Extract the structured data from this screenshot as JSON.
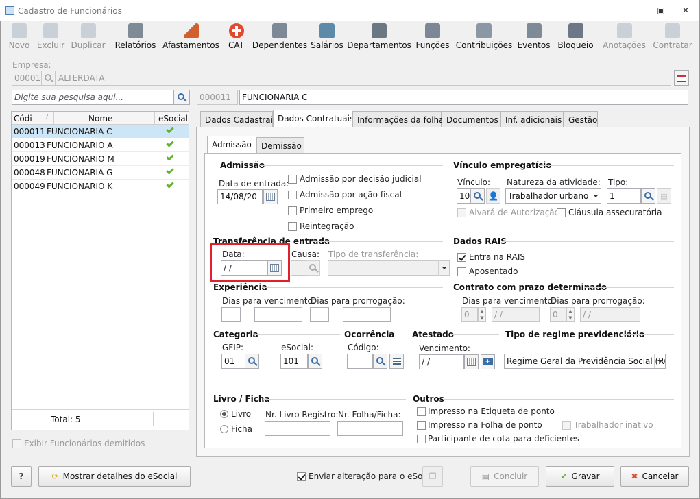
{
  "window": {
    "title": "Cadastro de Funcionários"
  },
  "toolbar": [
    {
      "label": "Novo",
      "icon": "new-icon",
      "disabled": true,
      "color": "#9aa9b8"
    },
    {
      "label": "Excluir",
      "icon": "trash-icon",
      "disabled": true,
      "color": "#9aa9b8"
    },
    {
      "label": "Duplicar",
      "icon": "duplicate-icon",
      "disabled": true,
      "color": "#9aa9b8"
    },
    {
      "label": "Relatórios",
      "icon": "report-icon",
      "disabled": false,
      "color": "#7e8a96"
    },
    {
      "label": "Afastamentos",
      "icon": "house-icon",
      "disabled": false,
      "color": "#d2602f"
    },
    {
      "label": "CAT",
      "icon": "medical-cross-icon",
      "disabled": false,
      "color": "#e2492f"
    },
    {
      "label": "Dependentes",
      "icon": "people-icon",
      "disabled": false,
      "color": "#7d8996"
    },
    {
      "label": "Salários",
      "icon": "money-icon",
      "disabled": false,
      "color": "#5d8aa8"
    },
    {
      "label": "Departamentos",
      "icon": "desk-icon",
      "disabled": false,
      "color": "#6b7884"
    },
    {
      "label": "Funções",
      "icon": "badge-icon",
      "disabled": false,
      "color": "#7b8794"
    },
    {
      "label": "Contribuições",
      "icon": "contribution-icon",
      "disabled": false,
      "color": "#8b97a4"
    },
    {
      "label": "Eventos",
      "icon": "list-icon",
      "disabled": false,
      "color": "#7e8a96"
    },
    {
      "label": "Bloqueio",
      "icon": "lock-icon",
      "disabled": false,
      "color": "#6c7885"
    },
    {
      "label": "Anotações",
      "icon": "notes-icon",
      "disabled": true,
      "color": "#9aa9b8"
    },
    {
      "label": "Contratar",
      "icon": "hire-icon",
      "disabled": true,
      "color": "#9aa9b8"
    }
  ],
  "empresa": {
    "label": "Empresa:",
    "code": "00001",
    "name": "ALTERDATA"
  },
  "search": {
    "placeholder": "Digite sua pesquisa aqui..."
  },
  "selected": {
    "code": "000011",
    "name": "FUNCIONARIA C"
  },
  "grid": {
    "headers": [
      "Códi",
      "Nome",
      "eSocial"
    ],
    "rows": [
      {
        "code": "000011",
        "name": "FUNCIONARIA C"
      },
      {
        "code": "000013",
        "name": "FUNCIONARIO A"
      },
      {
        "code": "000019",
        "name": "FUNCIONARIO M"
      },
      {
        "code": "000048",
        "name": "FUNCIONARIA G"
      },
      {
        "code": "000049",
        "name": "FUNCIONARIO K"
      }
    ],
    "total": "Total: 5"
  },
  "show_dismissed": "Exibir Funcionários demitidos",
  "tabs": [
    "Dados Cadastrais",
    "Dados Contratuais",
    "Informações da folha",
    "Documentos",
    "Inf. adicionais",
    "Gestão"
  ],
  "subtabs": [
    "Admissão",
    "Demissão"
  ],
  "admissao": {
    "title": "Admissão",
    "data_label": "Data de entrada:",
    "data_value": "14/08/20",
    "checks": [
      "Admissão por decisão judicial",
      "Admissão por ação fiscal",
      "Primeiro emprego",
      "Reintegração"
    ]
  },
  "vinculo": {
    "title": "Vínculo empregatício",
    "vinculo_label": "Vínculo:",
    "vinculo_value": "10",
    "natureza_label": "Natureza da atividade:",
    "natureza_value": "Trabalhador urbano",
    "tipo_label": "Tipo:",
    "tipo_value": "1",
    "alvara": "Alvará de Autorização",
    "clausula": "Cláusula assecuratória"
  },
  "transferencia": {
    "title": "Transferência de entrada",
    "data_label": "Data:",
    "data_value": " / /",
    "causa_label": "Causa:",
    "tipo_label": "Tipo de transferência:"
  },
  "rais": {
    "title": "Dados RAIS",
    "entra": "Entra na RAIS",
    "aposentado": "Aposentado"
  },
  "experiencia": {
    "title": "Experiência",
    "venc_label": "Dias para vencimento:",
    "prorrog_label": "Dias para prorrogação:"
  },
  "contrato": {
    "title": "Contrato com prazo determinado",
    "venc_label": "Dias para vencimento:",
    "prorrog_label": "Dias para prorrogação:",
    "venc_value": "0",
    "venc_date": " / /",
    "prorrog_value": "0",
    "prorrog_date": " / /"
  },
  "categoria": {
    "title": "Categoria",
    "gfip_label": "GFIP:",
    "gfip_value": "01",
    "esocial_label": "eSocial:",
    "esocial_value": "101"
  },
  "ocorrencia": {
    "title": "Ocorrência",
    "codigo_label": "Código:"
  },
  "atestado": {
    "title": "Atestado",
    "venc_label": "Vencimento:",
    "venc_value": " / /"
  },
  "regime": {
    "title": "Tipo de regime previdenciário",
    "value": "Regime Geral da Previdência Social (RGP"
  },
  "livro": {
    "title": "Livro / Ficha",
    "opt1": "Livro",
    "opt2": "Ficha",
    "nr_livro": "Nr. Livro Registro:",
    "nr_folha": "Nr. Folha/Ficha:"
  },
  "outros": {
    "title": "Outros",
    "items": [
      "Impresso na Etiqueta de ponto",
      "Impresso na Folha de ponto",
      "Participante de cota para deficientes"
    ],
    "inativo": "Trabalhador inativo"
  },
  "footer": {
    "help": "?",
    "details": "Mostrar detalhes do eSocial",
    "send": "Enviar alteração para o eSocial",
    "concluir": "Concluir",
    "gravar": "Gravar",
    "cancelar": "Cancelar"
  },
  "colors": {
    "highlight": "#e0202a",
    "selected_row": "#cde6f7",
    "check_green": "#62b32a"
  }
}
